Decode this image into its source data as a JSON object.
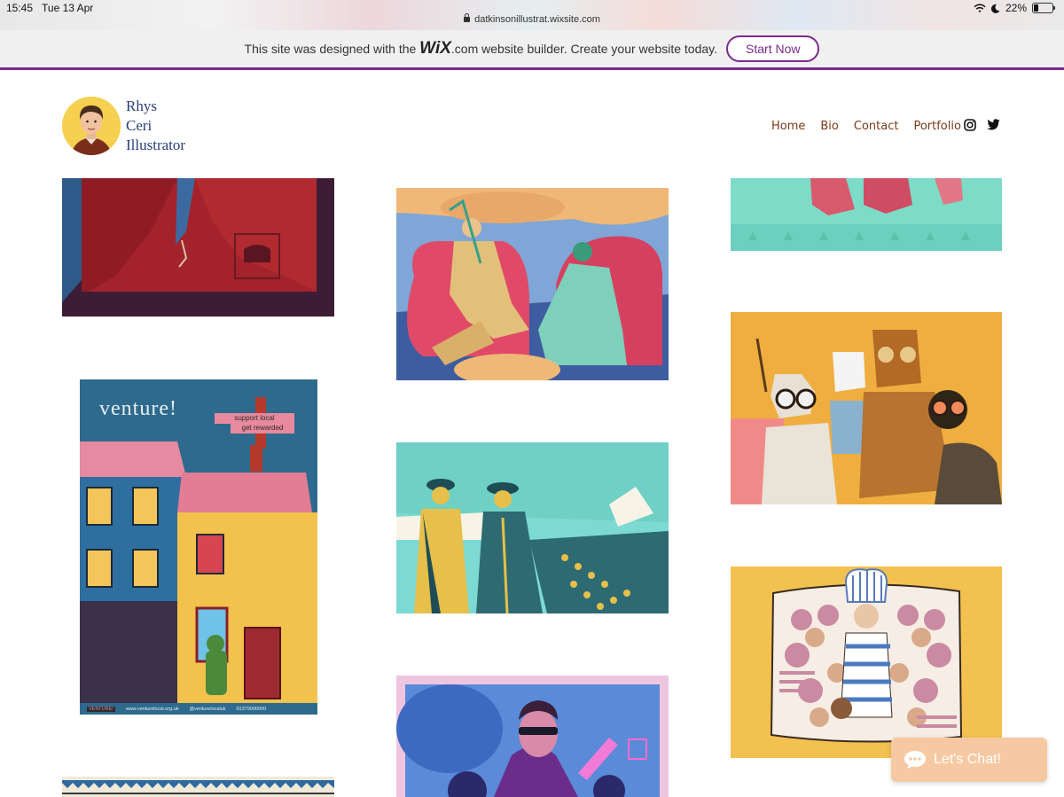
{
  "status": {
    "time": "15:45",
    "date": "Tue 13 Apr",
    "url": "datkinsonillustrat.wixsite.com",
    "battery": "22%"
  },
  "wix_banner": {
    "prefix": "This site was designed with the",
    "brand": "WiX",
    "suffix": ".com website builder. Create your website today.",
    "cta": "Start Now"
  },
  "site": {
    "name_line1": "Rhys",
    "name_line2": "Ceri",
    "name_line3": "Illustrator"
  },
  "nav": {
    "items": [
      "Home",
      "Bio",
      "Contact",
      "Portfolio"
    ]
  },
  "social": [
    "instagram-icon",
    "twitter-icon"
  ],
  "venture_poster": {
    "title": "venture!",
    "tag1": "support local",
    "tag2": "get rewarded",
    "footer_brand": "VENTURE!",
    "footer_url": "www.venturelocal.org.uk",
    "footer_handle": "@venturelocaluk",
    "footer_phone": "01379000000"
  },
  "chat": {
    "label": "Let's Chat!"
  },
  "colors": {
    "accent": "#7a2b8c",
    "nav_text": "#7a3a18",
    "logo_text": "#2a3f7a",
    "chat_bg": "#f7c9a2"
  }
}
